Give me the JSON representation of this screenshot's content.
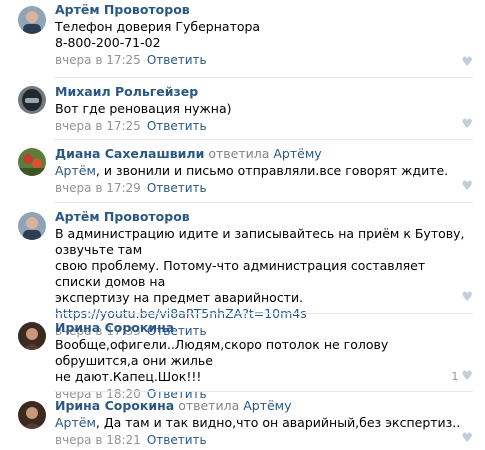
{
  "colors": {
    "link": "#2a5885",
    "meta": "#939393",
    "like": "#c4ced9"
  },
  "reply_label": "Ответить",
  "comments": [
    {
      "author": "Артём Провоторов",
      "text_lines": [
        "Телефон доверия Губернатора",
        "8-800-200-71-02"
      ],
      "time": "вчера в 17:25",
      "avatar_icon": "man-avatar-icon"
    },
    {
      "author": "Михаил Рольгейзер",
      "text_lines": [
        "Вот где реновация нужна)"
      ],
      "time": "вчера в 17:25",
      "avatar_icon": "helmet-avatar-icon"
    },
    {
      "author": "Диана Сахелашвили",
      "reply_prefix": "ответила",
      "reply_to": "Артёму",
      "text_lines": [
        "Артём, и звонили и письмо отправляли.все говорят ждите."
      ],
      "text_mention": "Артём",
      "time": "вчера в 17:29",
      "avatar_icon": "flower-avatar-icon"
    },
    {
      "author": "Артём Провоторов",
      "text_lines": [
        "В администрацию идите и записывайтесь на приём к Бутову, озвучьте там",
        "свою проблему. Потому-что администрация составляет списки домов на",
        "экспертизу на предмет аварийности."
      ],
      "link": "https://youtu.be/vi8aRT5nhZA?t=10m4s",
      "time": "вчера в 17:33",
      "avatar_icon": "man-avatar-icon"
    },
    {
      "author": "Ирина Сорокина",
      "text_lines": [
        "Вообще,офигели..Людям,скоро потолок не голову обрушится,а они жилье",
        "не дают.Капец.Шок!!!"
      ],
      "time": "вчера в 18:20",
      "likes": "1",
      "avatar_icon": "woman-avatar-icon"
    },
    {
      "author": "Ирина Сорокина",
      "reply_prefix": "ответила",
      "reply_to": "Артёму",
      "text_lines": [
        "Артём, Да там и так видно,что он аварийный,без экспертиз.."
      ],
      "text_mention": "Артём",
      "time": "вчера в 18:21",
      "avatar_icon": "woman-avatar-icon"
    }
  ]
}
